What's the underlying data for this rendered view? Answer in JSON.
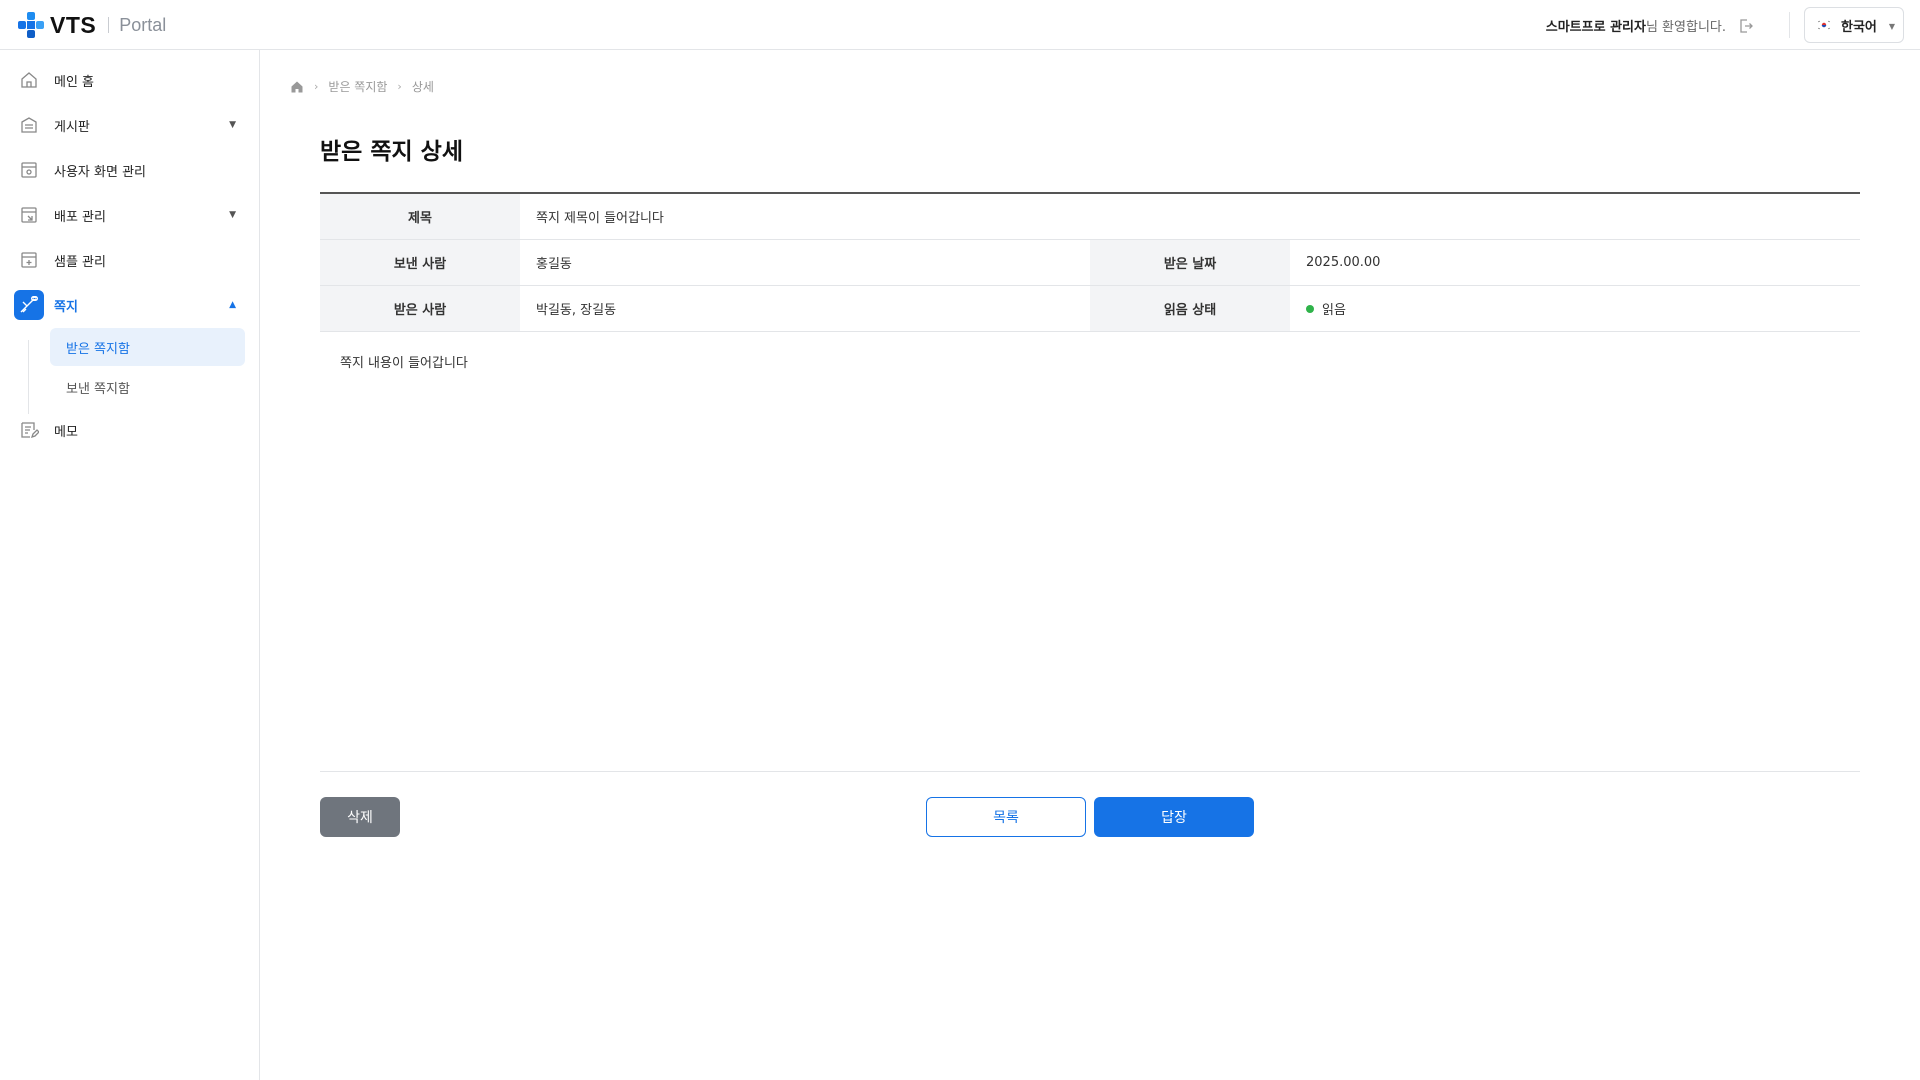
{
  "header": {
    "logo_text": "VTS",
    "portal_text": "Portal",
    "user_name": "스마트프로 관리자",
    "welcome_suffix": "님 환영합니다.",
    "language": "한국어"
  },
  "sidebar": {
    "items": [
      {
        "label": "메인 홈",
        "icon": "home-icon"
      },
      {
        "label": "게시판",
        "icon": "board-icon"
      },
      {
        "label": "사용자 화면 관리",
        "icon": "screen-settings-icon"
      },
      {
        "label": "배포 관리",
        "icon": "deploy-icon"
      },
      {
        "label": "샘플 관리",
        "icon": "sample-icon"
      },
      {
        "label": "쪽지",
        "icon": "message-icon"
      },
      {
        "label": "메모",
        "icon": "memo-icon"
      }
    ],
    "sub_items": [
      {
        "label": "받은 쪽지함"
      },
      {
        "label": "보낸 쪽지함"
      }
    ]
  },
  "breadcrumb": {
    "level1": "받은 쪽지함",
    "level2": "상세"
  },
  "page": {
    "title": "받은 쪽지 상세"
  },
  "detail": {
    "subject_label": "제목",
    "subject_value": "쪽지 제목이 들어갑니다",
    "sender_label": "보낸 사람",
    "sender_value": "홍길동",
    "received_date_label": "받은 날짜",
    "received_date_value": "2025.00.00",
    "recipient_label": "받은 사람",
    "recipient_value": "박길동, 장길동",
    "read_status_label": "읽음 상태",
    "read_status_value": "읽음",
    "content": "쪽지 내용이 들어갑니다"
  },
  "buttons": {
    "delete": "삭제",
    "list": "목록",
    "reply": "답장"
  },
  "colors": {
    "accent": "#1673e6",
    "read_status": "#2fb34a",
    "delete_button": "#6f757d"
  }
}
